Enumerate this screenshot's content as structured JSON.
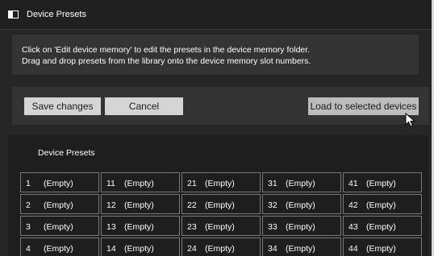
{
  "window": {
    "title": "Device Presets",
    "icon": "window-panel-icon"
  },
  "info": {
    "line1": "Click on 'Edit device memory' to edit the presets in the device memory folder.",
    "line2": "Drag and drop presets from the library onto the device memory slot numbers."
  },
  "actions": {
    "save_label": "Save changes",
    "cancel_label": "Cancel",
    "load_label": "Load to selected devices"
  },
  "presets": {
    "title": "Device Presets",
    "slots": [
      {
        "number": "1",
        "value": "(Empty)"
      },
      {
        "number": "11",
        "value": "(Empty)"
      },
      {
        "number": "21",
        "value": "(Empty)"
      },
      {
        "number": "31",
        "value": "(Empty)"
      },
      {
        "number": "41",
        "value": "(Empty)"
      },
      {
        "number": "2",
        "value": "(Empty)"
      },
      {
        "number": "12",
        "value": "(Empty)"
      },
      {
        "number": "22",
        "value": "(Empty)"
      },
      {
        "number": "32",
        "value": "(Empty)"
      },
      {
        "number": "42",
        "value": "(Empty)"
      },
      {
        "number": "3",
        "value": "(Empty)"
      },
      {
        "number": "13",
        "value": "(Empty)"
      },
      {
        "number": "23",
        "value": "(Empty)"
      },
      {
        "number": "33",
        "value": "(Empty)"
      },
      {
        "number": "43",
        "value": "(Empty)"
      },
      {
        "number": "4",
        "value": "(Empty)"
      },
      {
        "number": "14",
        "value": "(Empty)"
      },
      {
        "number": "24",
        "value": "(Empty)"
      },
      {
        "number": "34",
        "value": "(Empty)"
      },
      {
        "number": "44",
        "value": "(Empty)"
      }
    ]
  },
  "colors": {
    "window_bg": "#262626",
    "panel_bg": "#333333",
    "presets_bg": "#1e1e1e",
    "button_bg": "#d5d5d5",
    "slot_border": "#7a7a7a"
  }
}
